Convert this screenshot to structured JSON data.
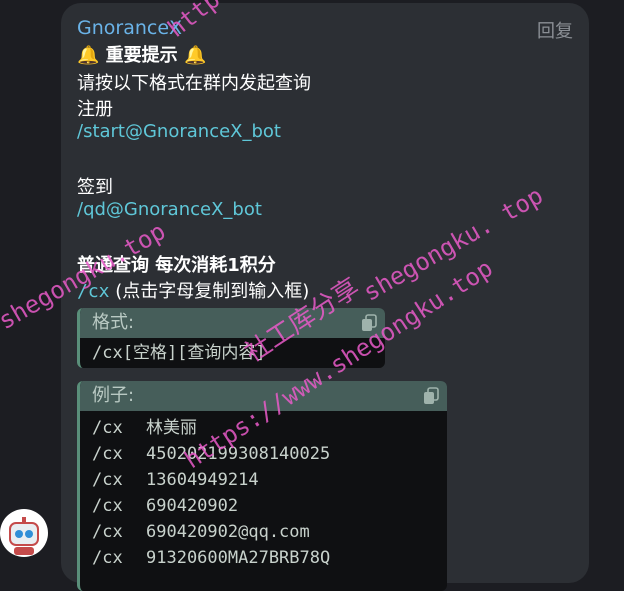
{
  "message": {
    "sender": "GnoranceX",
    "reply_label": "回复",
    "title": "🔔 重要提示 🔔",
    "intro": "请按以下格式在群内发起查询",
    "register_label": "注册",
    "register_cmd": "/start@GnoranceX_bot",
    "signin_label": "签到",
    "signin_cmd": "/qd@GnoranceX_bot",
    "query_heading": "普通查询 每次消耗1积分",
    "query_cmd": "/cx",
    "query_hint": " (点击字母复制到输入框)",
    "format_block": {
      "title": "格式:",
      "content": "/cx[空格][查询内容]"
    },
    "example_block": {
      "title": "例子:",
      "rows": [
        {
          "cmd": "/cx",
          "value": "林美丽"
        },
        {
          "cmd": "/cx",
          "value": "450202199308140025"
        },
        {
          "cmd": "/cx",
          "value": "13604949214"
        },
        {
          "cmd": "/cx",
          "value": "690420902"
        },
        {
          "cmd": "/cx",
          "value": "690420902@qq.com"
        },
        {
          "cmd": "/cx",
          "value": "91320600MA27BRB78Q"
        }
      ]
    }
  },
  "watermark": {
    "main": "社工库分享",
    "url": "https://www.shegongku.top",
    "short1": "http",
    "short2": "shegongku.top",
    "short3": "shegongku. top"
  },
  "colors": {
    "accent": "#5fc7d8",
    "sender": "#6ab3e8",
    "watermark": "#e95ac9"
  }
}
